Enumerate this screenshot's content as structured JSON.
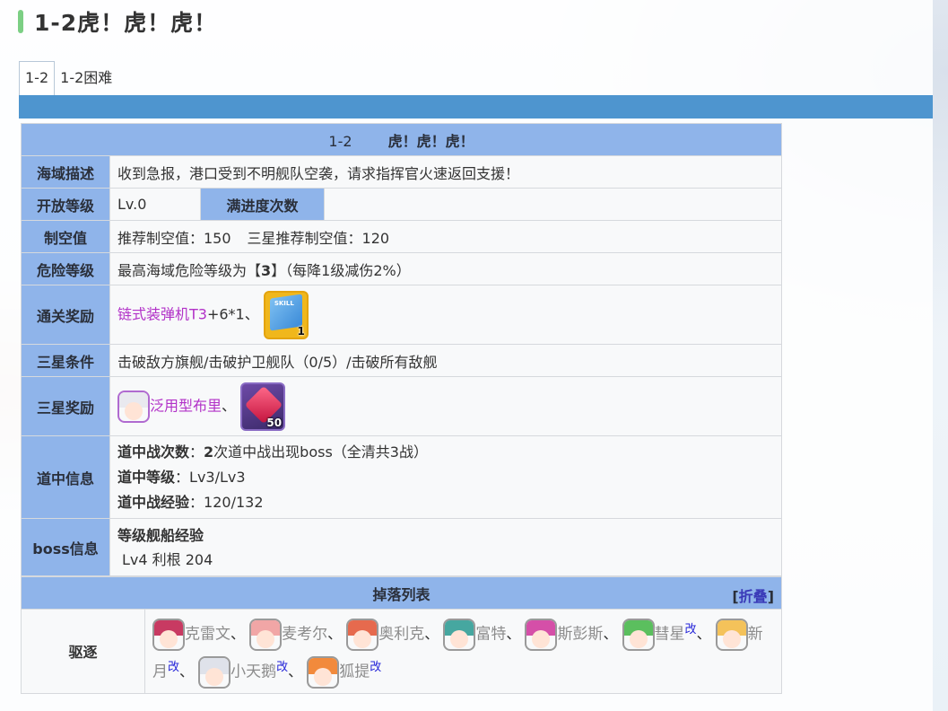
{
  "title": "1-2虎！虎！虎！",
  "tabs": [
    "1-2",
    "1-2困难"
  ],
  "colors": {
    "accent_bar": "#7ccf84",
    "tab_strip": "#4e95cf",
    "header_bg": "#8fb4ea",
    "link_purple": "#b232c8",
    "mod_blue": "#2424d8"
  },
  "stage": {
    "code": "1-2",
    "name": "虎！虎！虎！",
    "rows": {
      "description": {
        "label": "海域描述",
        "value": "收到急报，港口受到不明舰队空袭，请求指挥官火速返回支援！"
      },
      "open_level": {
        "label": "开放等级",
        "value": "Lv.0",
        "progress_label": "满进度次数",
        "progress_value": ""
      },
      "air": {
        "label": "制空值",
        "recommended": "推荐制空值：150",
        "three_star": "三星推荐制空值：120"
      },
      "danger": {
        "label": "危险等级",
        "prefix": "最高海域危险等级为【",
        "level": "3",
        "suffix": "】（每降1级减伤2%）"
      },
      "clear_reward": {
        "label": "通关奖励",
        "item": "链式装弹机T3",
        "qty": "+6*1、",
        "book_text": "SKILL",
        "book_count": "1",
        "icon": "skill-book-icon"
      },
      "three_star_cond": {
        "label": "三星条件",
        "value": "击破敌方旗舰/击破护卫舰队（0/5）/击破所有敌舰"
      },
      "three_star_reward": {
        "label": "三星奖励",
        "ship": "泛用型布里",
        "sep": "、",
        "gem_count": "50",
        "icon": "gem-icon"
      },
      "route": {
        "label": "道中信息",
        "colon": "：",
        "battles_label": "道中战次数",
        "battles_num": "2",
        "battles_text": "次道中战出现boss（全清共3战）",
        "level_label": "道中等级",
        "level_value": "Lv3/Lv3",
        "exp_label": "道中战经验",
        "exp_value": "120/132"
      },
      "boss": {
        "label": "boss信息",
        "header": "等级舰船经验",
        "value": "Lv4 利根 204"
      }
    }
  },
  "drops": {
    "title": "掉落列表",
    "fold_label": "折叠",
    "category": "驱逐",
    "mod": "改",
    "ships": [
      "克雷文",
      "麦考尔",
      "奥利克",
      "富特",
      "斯彭斯",
      "彗星",
      "新月",
      "小天鹅",
      "狐提"
    ]
  }
}
